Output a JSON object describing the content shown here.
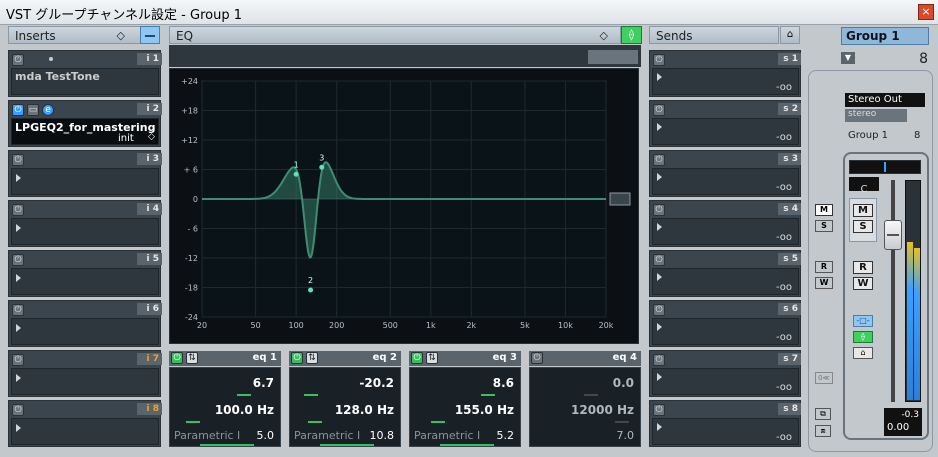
{
  "window": {
    "title": "VST グループチャンネル設定 - Group 1",
    "close_label": "×"
  },
  "inserts": {
    "header": "Inserts",
    "slots": [
      {
        "tag": "i 1",
        "name": "mda TestTone",
        "preset": ""
      },
      {
        "tag": "i 2",
        "name": "LPGEQ2_for_mastering",
        "preset": "init"
      },
      {
        "tag": "i 3",
        "name": "",
        "preset": ""
      },
      {
        "tag": "i 4",
        "name": "",
        "preset": ""
      },
      {
        "tag": "i 5",
        "name": "",
        "preset": ""
      },
      {
        "tag": "i 6",
        "name": "",
        "preset": ""
      },
      {
        "tag": "i 7",
        "name": "",
        "preset": ""
      },
      {
        "tag": "i 8",
        "name": "",
        "preset": ""
      }
    ]
  },
  "eq": {
    "header": "EQ",
    "y_ticks": [
      "+24",
      "+18",
      "+12",
      "+ 6",
      "0",
      "- 6",
      "-12",
      "-18",
      "-24"
    ],
    "x_ticks": [
      "20",
      "50",
      "100",
      "200",
      "500",
      "1k",
      "2k",
      "5k",
      "10k",
      "20k"
    ],
    "points": [
      {
        "label": "1",
        "freq": 100,
        "gain": 6.7
      },
      {
        "label": "2",
        "freq": 128,
        "gain": -20.2
      },
      {
        "label": "3",
        "freq": 155,
        "gain": 8.6
      }
    ],
    "bands": [
      {
        "tag": "eq 1",
        "gain": "6.7",
        "freq": "100.0 Hz",
        "type": "Parametric I",
        "q": "5.0",
        "enabled": true,
        "gain_fill": 0.64,
        "freq_fill": 0.12
      },
      {
        "tag": "eq 2",
        "gain": "-20.2",
        "freq": "128.0 Hz",
        "type": "Parametric I",
        "q": "10.8",
        "enabled": true,
        "gain_fill": 0.08,
        "freq_fill": 0.15
      },
      {
        "tag": "eq 3",
        "gain": "8.6",
        "freq": "155.0 Hz",
        "type": "Parametric I",
        "q": "5.2",
        "enabled": true,
        "gain_fill": 0.68,
        "freq_fill": 0.18
      },
      {
        "tag": "eq 4",
        "gain": "0.0",
        "freq": "12000 Hz",
        "type": "",
        "q": "7.0",
        "enabled": false,
        "gain_fill": 0.5,
        "freq_fill": 0.84
      }
    ]
  },
  "sends": {
    "header": "Sends",
    "slots": [
      {
        "tag": "s 1",
        "value": "-oo"
      },
      {
        "tag": "s 2",
        "value": "-oo"
      },
      {
        "tag": "s 3",
        "value": "-oo"
      },
      {
        "tag": "s 4",
        "value": "-oo"
      },
      {
        "tag": "s 5",
        "value": "-oo"
      },
      {
        "tag": "s 6",
        "value": "-oo"
      },
      {
        "tag": "s 7",
        "value": "-oo"
      },
      {
        "tag": "s 8",
        "value": "-oo"
      }
    ]
  },
  "channel": {
    "name": "Group 1",
    "number": "8",
    "output": "Stereo Out",
    "format": "stereo",
    "label": "Group 1",
    "label_number": "8",
    "pan": "C",
    "peak": "-0.3",
    "fader": "0.00",
    "buttons": {
      "mute": "M",
      "solo": "S",
      "read": "R",
      "write": "W"
    },
    "meter_level": 0.72
  },
  "colors": {
    "accent": "#3aa0ff",
    "eq_curve": "#3e8c72",
    "eq_point": "#5fe0b8",
    "active": "#38c060"
  }
}
